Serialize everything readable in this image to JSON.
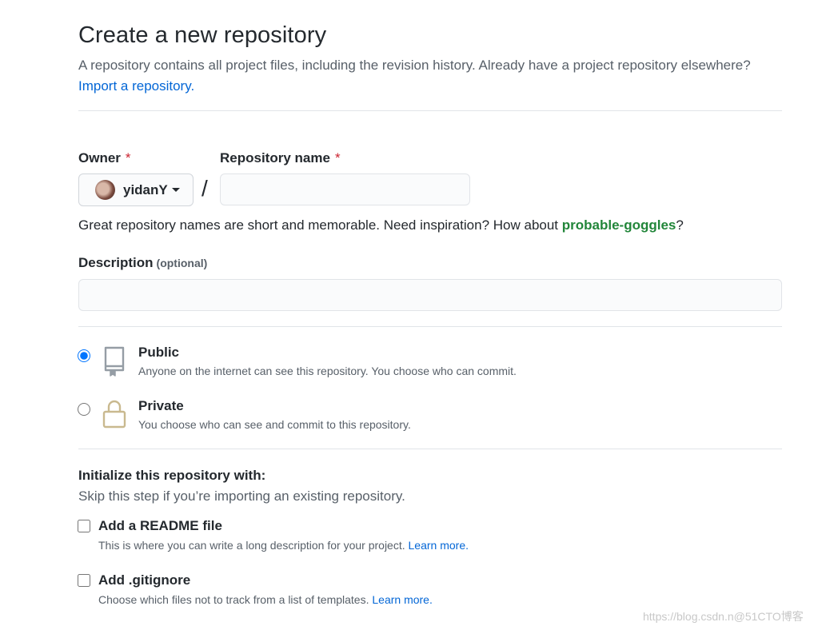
{
  "header": {
    "title": "Create a new repository",
    "subtitle": "A repository contains all project files, including the revision history. Already have a project repository elsewhere?",
    "import_link": "Import a repository."
  },
  "owner": {
    "label": "Owner",
    "required_mark": "*",
    "value": "yidanY"
  },
  "repo_name": {
    "label": "Repository name",
    "required_mark": "*",
    "value": "",
    "separator": "/"
  },
  "hint": {
    "text": "Great repository names are short and memorable. Need inspiration? How about ",
    "suggestion": "probable-goggles",
    "suffix": "?"
  },
  "description": {
    "label": "Description",
    "optional": "(optional)",
    "value": ""
  },
  "visibility": {
    "selected": "public",
    "public": {
      "title": "Public",
      "desc": "Anyone on the internet can see this repository. You choose who can commit."
    },
    "private": {
      "title": "Private",
      "desc": "You choose who can see and commit to this repository."
    }
  },
  "init": {
    "title": "Initialize this repository with:",
    "subtitle": "Skip this step if you’re importing an existing repository.",
    "readme": {
      "title": "Add a README file",
      "desc": "This is where you can write a long description for your project.",
      "learn": "Learn more."
    },
    "gitignore": {
      "title": "Add .gitignore",
      "desc": "Choose which files not to track from a list of templates.",
      "learn": "Learn more."
    }
  },
  "watermark": "https://blog.csdn.n@51CTO博客",
  "colors": {
    "link": "#0366d6",
    "required": "#cb2431",
    "suggestion": "#22863a"
  }
}
